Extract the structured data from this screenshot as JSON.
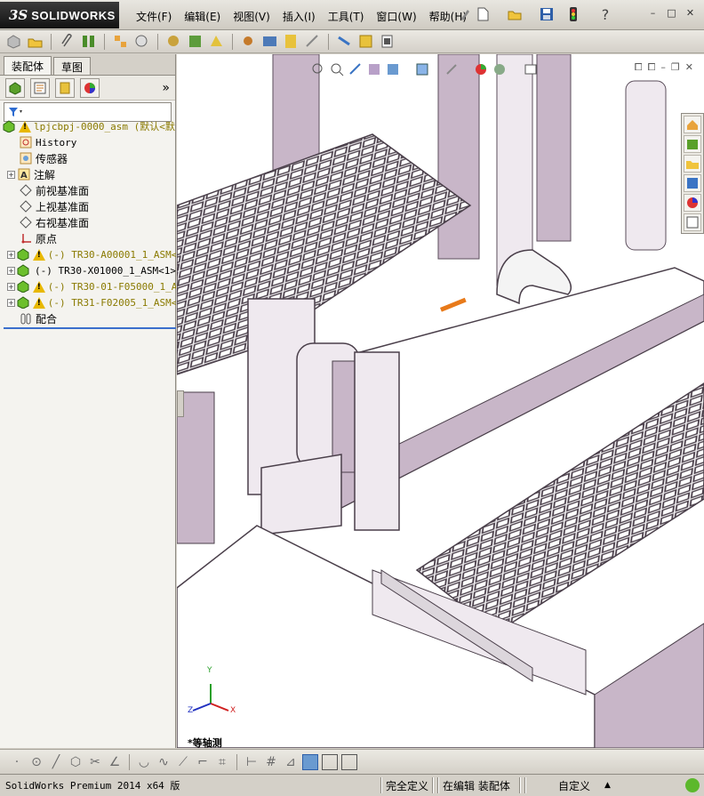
{
  "app": {
    "logo_prefix": "3S",
    "logo_name": "SOLIDWORKS"
  },
  "menu": [
    {
      "label": "文件(F)"
    },
    {
      "label": "编辑(E)"
    },
    {
      "label": "视图(V)"
    },
    {
      "label": "插入(I)"
    },
    {
      "label": "工具(T)"
    },
    {
      "label": "窗口(W)"
    },
    {
      "label": "帮助(H)"
    }
  ],
  "help_glyph": "?",
  "window_controls": {
    "minimize": "–",
    "restore": "□",
    "close": "✕"
  },
  "panel": {
    "tabs": [
      {
        "label": "装配体"
      },
      {
        "label": "草图"
      }
    ],
    "more_glyph": "»"
  },
  "tree": {
    "root": {
      "label": "lpjcbpj-0000_asm  (默认<默",
      "color": "#8a7a00"
    },
    "items": [
      {
        "label": "History",
        "icon": "history-icon"
      },
      {
        "label": "传感器",
        "icon": "sensor-icon"
      },
      {
        "label": "注解",
        "icon": "annotation-icon",
        "expander": "+"
      },
      {
        "label": "前视基准面",
        "icon": "plane-icon"
      },
      {
        "label": "上视基准面",
        "icon": "plane-icon"
      },
      {
        "label": "右视基准面",
        "icon": "plane-icon"
      },
      {
        "label": "原点",
        "icon": "origin-icon"
      },
      {
        "label": "(-) TR30-A00001_1_ASM<1",
        "icon": "assembly-icon",
        "warning": true,
        "expander": "+"
      },
      {
        "label": "(-) TR30-X01000_1_ASM<1>",
        "icon": "assembly-icon",
        "warning": false,
        "expander": "+"
      },
      {
        "label": "(-) TR30-01-F05000_1_AS",
        "icon": "assembly-icon",
        "warning": true,
        "expander": "+"
      },
      {
        "label": "(-) TR31-F02005_1_ASM<1",
        "icon": "assembly-icon",
        "warning": true,
        "expander": "+"
      },
      {
        "label": "配合",
        "icon": "mates-icon"
      }
    ]
  },
  "graphics": {
    "view_label": "*等轴测",
    "triad": {
      "x": "X",
      "y": "Y",
      "z": "Z"
    }
  },
  "status": {
    "product": "SolidWorks Premium 2014 x64 版",
    "definition": "完全定义",
    "editing": "在编辑 装配体",
    "units": "自定义",
    "caret": "▲"
  },
  "colors": {
    "frame_purple": "#c8b6c8",
    "frame_dark": "#6a5a6a",
    "tree_line": "#3b6fcc"
  }
}
